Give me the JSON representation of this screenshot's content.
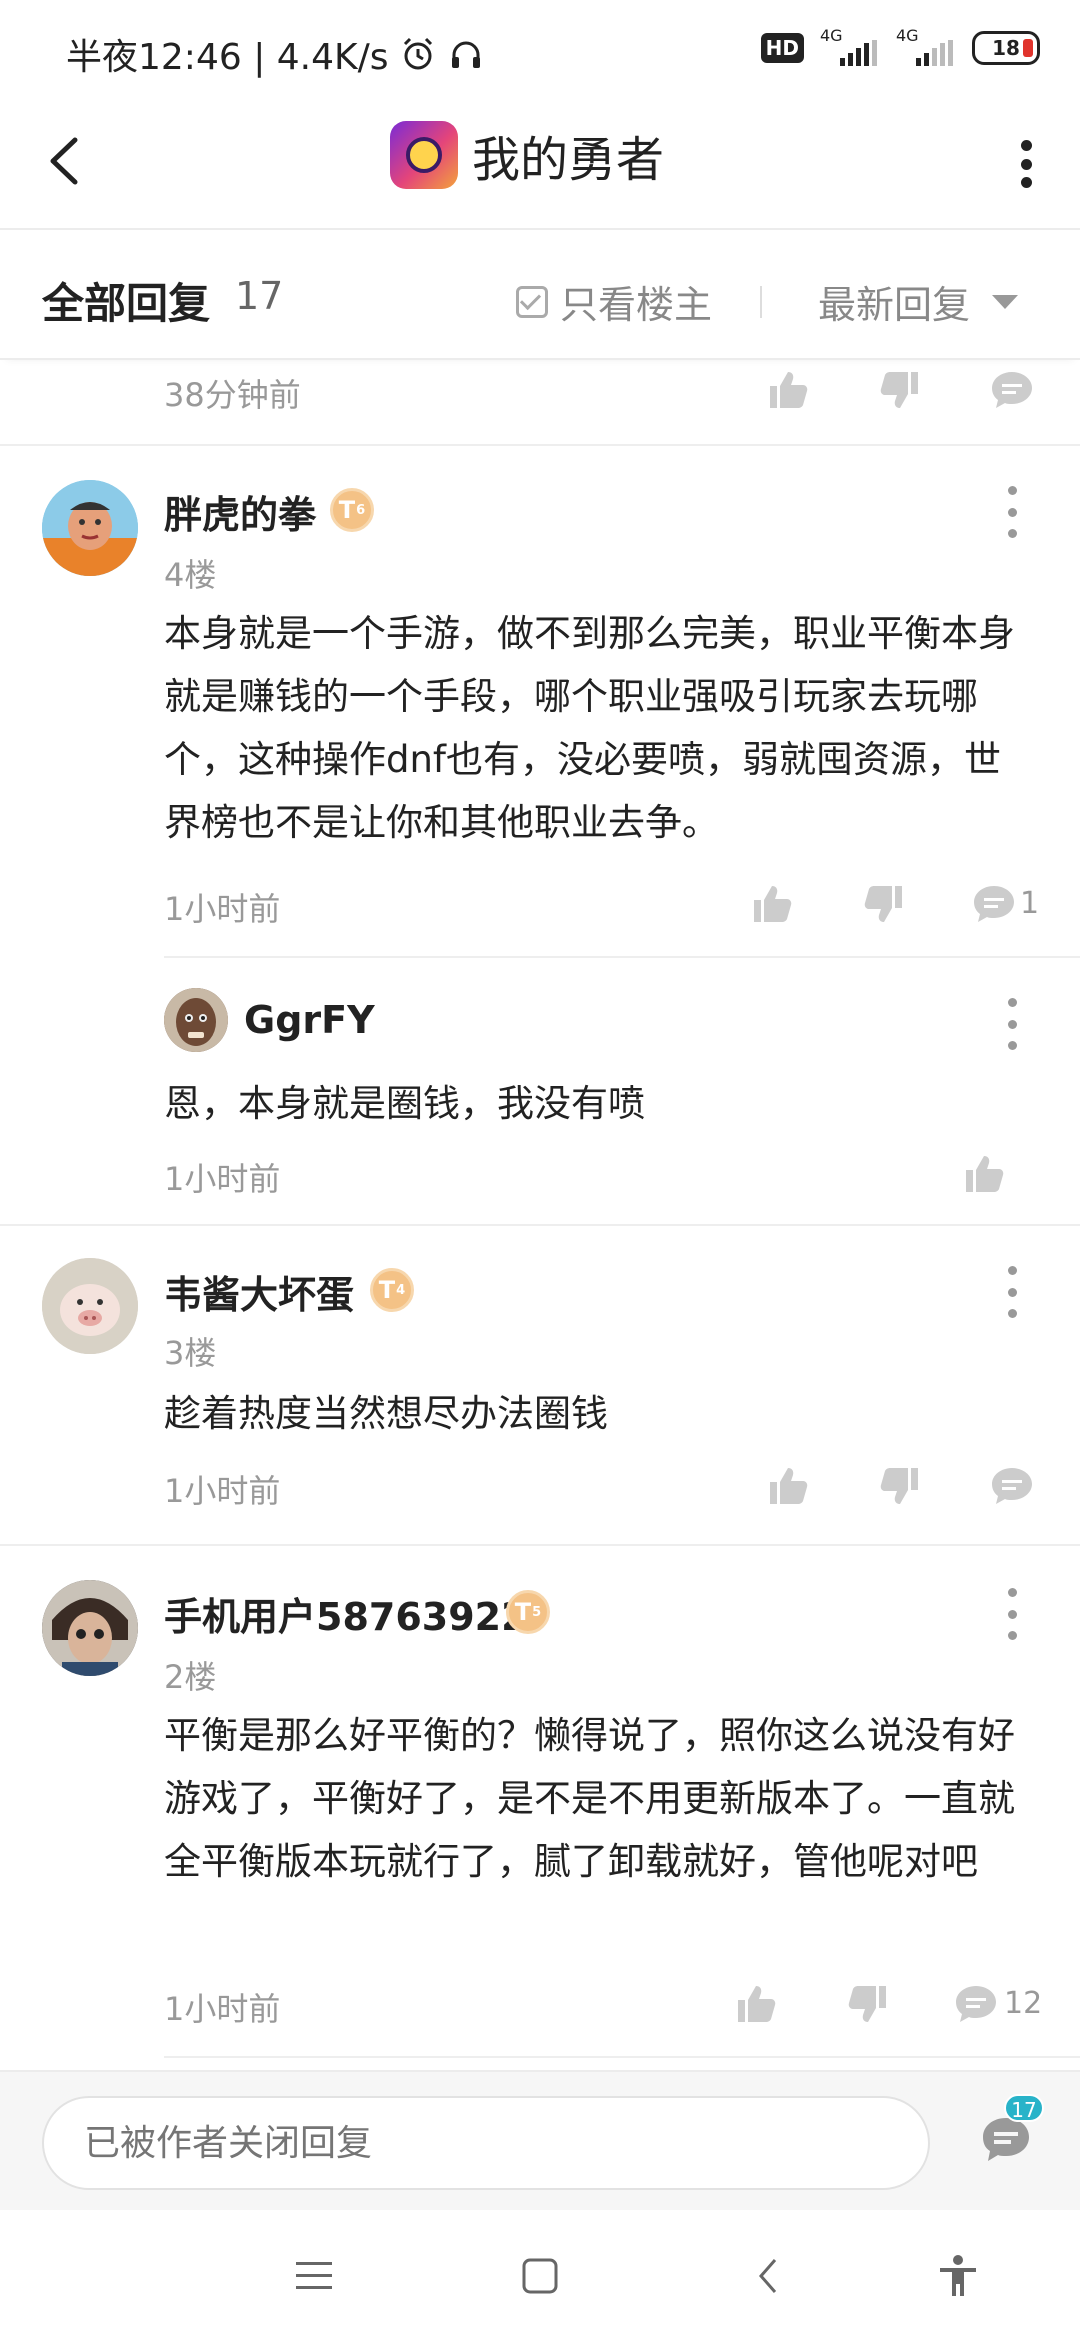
{
  "status_bar": {
    "time_speed": "半夜12:46 | 4.4K/s",
    "hd_label": "HD",
    "network_1": "4G",
    "network_2": "4G",
    "battery": "18"
  },
  "header": {
    "title": "我的勇者",
    "icons": {
      "back": "back-arrow-icon",
      "more": "more-vertical-icon",
      "app": "app-icon"
    }
  },
  "filter_bar": {
    "all_replies_label": "全部回复",
    "reply_count": "17",
    "only_op_label": "只看楼主",
    "sort_label": "最新回复"
  },
  "feed": {
    "partial_top": {
      "time": "38分钟前"
    },
    "comments": [
      {
        "username": "胖虎的拳",
        "level": "T",
        "level_num": "6",
        "floor": "4楼",
        "text": "本身就是一个手游，做不到那么完美，职业平衡本身就是赚钱的一个手段，哪个职业强吸引玩家去玩哪个，这种操作dnf也有，没必要喷，弱就囤资源，世界榜也不是让你和其他职业去争。",
        "time": "1小时前",
        "reply_count": "1",
        "reply": {
          "username": "GgrFY",
          "text": "恩，本身就是圈钱，我没有喷",
          "time": "1小时前"
        }
      },
      {
        "username": "韦酱大坏蛋",
        "level": "T",
        "level_num": "4",
        "floor": "3楼",
        "text": "趁着热度当然想尽办法圈钱",
        "time": "1小时前"
      },
      {
        "username": "手机用户58763922",
        "level": "T",
        "level_num": "5",
        "floor": "2楼",
        "text": "平衡是那么好平衡的？懒得说了，照你这么说没有好游戏了，平衡好了，是不是不用更新版本了。一直就全平衡版本玩就行了，腻了卸载就好，管他呢对吧",
        "time": "1小时前",
        "reply_count": "12"
      }
    ]
  },
  "input_bar": {
    "placeholder": "已被作者关闭回复",
    "comment_badge": "17"
  },
  "colors": {
    "badge_gold": "#f4c286",
    "count_badge": "#28b3c9",
    "text_primary": "#222222",
    "text_secondary": "#999999"
  }
}
